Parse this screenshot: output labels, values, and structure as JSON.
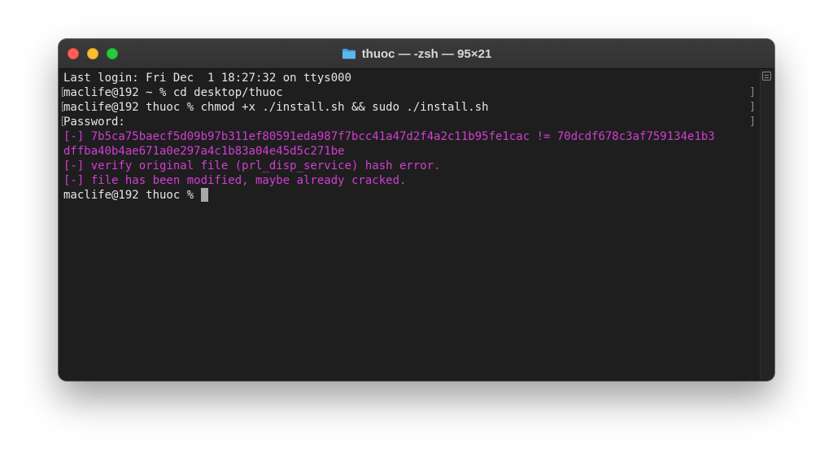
{
  "window": {
    "title": "thuoc — -zsh — 95×21",
    "folder_icon": "folder-icon",
    "accent_folder": "#3fa2e8"
  },
  "terminal": {
    "colors": {
      "text": "#e6e6e6",
      "error": "#d13fd3",
      "background": "#1e1e1e"
    },
    "lines": [
      {
        "text": "Last login: Fri Dec  1 18:27:32 on ttys000",
        "style": "normal",
        "marked": false
      },
      {
        "text": "maclife@192 ~ % cd desktop/thuoc",
        "style": "normal",
        "marked": true
      },
      {
        "text": "maclife@192 thuoc % chmod +x ./install.sh && sudo ./install.sh",
        "style": "normal",
        "marked": true
      },
      {
        "text": "Password:",
        "style": "normal",
        "marked": true
      },
      {
        "text": "[-] 7b5ca75baecf5d09b97b311ef80591eda987f7bcc41a47d2f4a2c11b95fe1cac != 70dcdf678c3af759134e1b3",
        "style": "err",
        "marked": false
      },
      {
        "text": "dffba40b4ae671a0e297a4c1b83a04e45d5c271be",
        "style": "err",
        "marked": false
      },
      {
        "text": "[-] verify original file (prl_disp_service) hash error.",
        "style": "err",
        "marked": false
      },
      {
        "text": "[-] file has been modified, maybe already cracked.",
        "style": "err",
        "marked": false
      }
    ],
    "prompt": "maclife@192 thuoc % "
  }
}
